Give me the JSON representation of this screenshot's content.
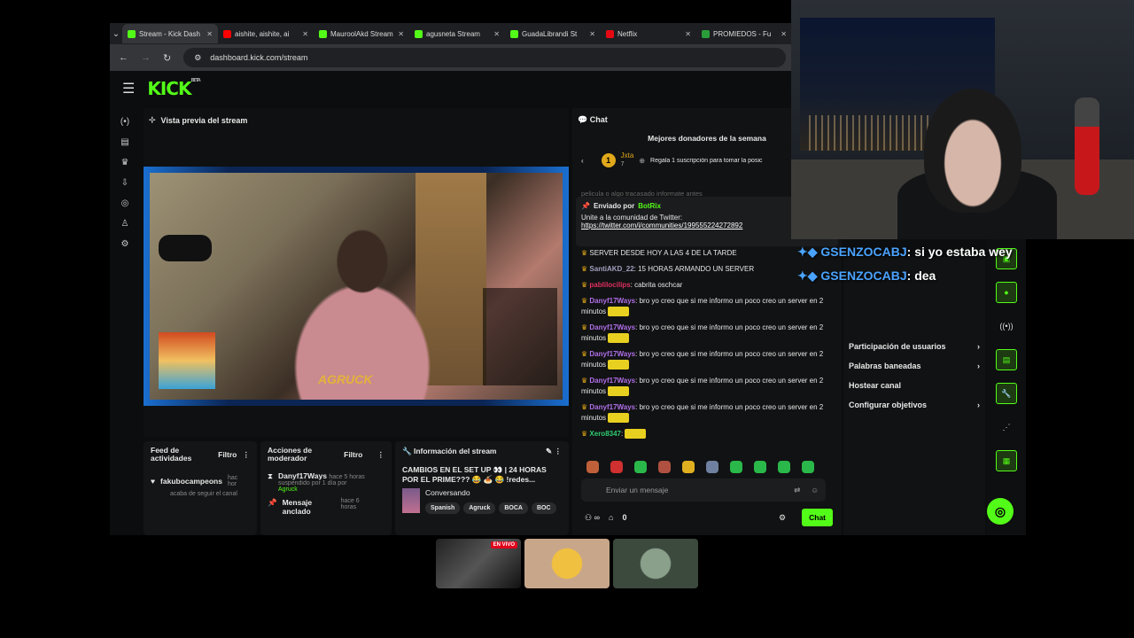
{
  "browser": {
    "tabs": [
      {
        "title": "Stream - Kick Dash",
        "icon": "kick-icon",
        "color": "#53fc18"
      },
      {
        "title": "aishite, aishite, ai",
        "icon": "youtube-icon",
        "color": "#ff0000"
      },
      {
        "title": "MauroolAkd Stream",
        "icon": "kick-icon",
        "color": "#53fc18"
      },
      {
        "title": "agusneta Stream",
        "icon": "kick-icon",
        "color": "#53fc18"
      },
      {
        "title": "GuadaLibrandi St",
        "icon": "kick-icon",
        "color": "#53fc18"
      },
      {
        "title": "Netflix",
        "icon": "netflix-icon",
        "color": "#e50914"
      },
      {
        "title": "PROMIEDOS - Fu",
        "icon": "promiedos-icon",
        "color": "#2a9d3a"
      }
    ],
    "url": "dashboard.kick.com/stream"
  },
  "kick": {
    "logo": "KICK",
    "logo_sup": "BETA",
    "preview_title": "Vista previa del stream",
    "stream_name": "AGRUCK",
    "panels": {
      "feed": {
        "title": "Feed de actividades",
        "filter": "Filtro",
        "user": "fakubocampeons",
        "time": "hac hor",
        "desc": "acaba de seguir el canal"
      },
      "mod": {
        "title": "Acciones de moderador",
        "filter": "Filtro",
        "user": "Danyf17Ways",
        "time": "hace 5 horas",
        "desc": "suspendido por 1 día por",
        "by": "Agruck",
        "item2": "Mensaje anclado",
        "time2": "hace 6 horas"
      },
      "info": {
        "title": "Información del stream",
        "stream_title": "CAMBIOS EN EL SET UP 👀 | 24 HORAS POR EL PRIME??? 😂 🍝 😂 !redes...",
        "category": "Conversando",
        "tags": [
          "Spanish",
          "Agruck",
          "BOCA",
          "BOC"
        ]
      }
    }
  },
  "chat": {
    "title": "Chat",
    "donors_title": "Mejores donadores de la semana",
    "donor": {
      "rank": "1",
      "name": "Jxta",
      "count": "7",
      "promo": "Regala 1 suscripción para tomar la posic"
    },
    "faded": "pelicula o algo tracasado informate antes",
    "pinned": {
      "label": "Enviado por",
      "bot": "BotRix",
      "text": "Unite a la comunidad de Twitter:",
      "link": "https://twitter.com/i/communities/199555224272892"
    },
    "messages": [
      {
        "user": "",
        "text": "SERVER DESDE HOY A LAS 4 DE LA TARDE",
        "color": "#ddd"
      },
      {
        "user": "SantiAKD_22",
        "text": ": 15 HORAS ARMANDO UN SERVER",
        "color": "#a0a0c0"
      },
      {
        "user": "pablilocilips",
        "text": ": cabrita oschcar",
        "color": "#e03060"
      },
      {
        "user": "Danyf17Ways",
        "text": ": bro yo creo que si me informo un poco creo un server en 2 minutos",
        "color": "#b06ee8"
      },
      {
        "user": "Danyf17Ways",
        "text": ": bro yo creo que si me informo un poco creo un server en 2 minutos",
        "color": "#b06ee8"
      },
      {
        "user": "Danyf17Ways",
        "text": ": bro yo creo que si me informo un poco creo un server en 2 minutos",
        "color": "#b06ee8"
      },
      {
        "user": "Danyf17Ways",
        "text": ": bro yo creo que si me informo un poco creo un server en 2 minutos",
        "color": "#b06ee8"
      },
      {
        "user": "Danyf17Ways",
        "text": ": bro yo creo que si me informo un poco creo un server en 2 minutos",
        "color": "#b06ee8"
      },
      {
        "user": "Xero8347",
        "text": ":",
        "color": "#2ecc71"
      }
    ],
    "input_placeholder": "Enviar un mensaje",
    "count": "0",
    "send": "Chat"
  },
  "menu": {
    "items": [
      "Participación de usuarios",
      "Palabras baneadas",
      "Hostear canal",
      "Configurar objetivos"
    ]
  },
  "overlay": {
    "lines": [
      {
        "user": "GSENZOCABJ",
        "text": "si yo estaba wey"
      },
      {
        "user": "GSENZOCABJ",
        "text": "dea"
      }
    ]
  },
  "bottom": {
    "live": "EN VIVO"
  }
}
